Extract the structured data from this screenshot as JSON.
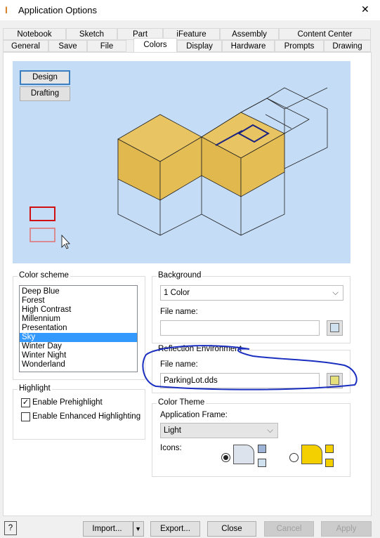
{
  "window": {
    "title": "Application Options",
    "close": "✕"
  },
  "tabs": {
    "row1": [
      "Notebook",
      "Sketch",
      "Part",
      "iFeature",
      "Assembly",
      "Content Center"
    ],
    "row2": [
      "General",
      "Save",
      "File",
      "Colors",
      "Display",
      "Hardware",
      "Prompts",
      "Drawing"
    ],
    "active": "Colors"
  },
  "preview": {
    "background": "#c4dcf5",
    "design_label": "Design",
    "drafting_label": "Drafting",
    "accent": "#e5bf5a"
  },
  "color_scheme": {
    "label": "Color scheme",
    "items": [
      "Deep Blue",
      "Forest",
      "High Contrast",
      "Millennium",
      "Presentation",
      "Sky",
      "Winter Day",
      "Winter Night",
      "Wonderland"
    ],
    "selected": "Sky"
  },
  "highlight": {
    "label": "Highlight",
    "enable_prehighlight": "Enable Prehighlight",
    "prehighlight_checked": true,
    "enable_enhanced": "Enable Enhanced Highlighting",
    "enhanced_checked": false
  },
  "background": {
    "label": "Background",
    "value": "1 Color",
    "file_name_label": "File name:",
    "file_name": ""
  },
  "reflection": {
    "label": "Reflection Environment",
    "file_name_label": "File name:",
    "file_name": "ParkingLot.dds",
    "annotation_color": "#1a2fc0"
  },
  "color_theme": {
    "label": "Color Theme",
    "app_frame_label": "Application Frame:",
    "app_frame_value": "Light",
    "icons_label": "Icons:",
    "icons_selected": "light"
  },
  "footer": {
    "import": "Import...",
    "export": "Export...",
    "close": "Close",
    "cancel": "Cancel",
    "apply": "Apply",
    "help": "?"
  }
}
